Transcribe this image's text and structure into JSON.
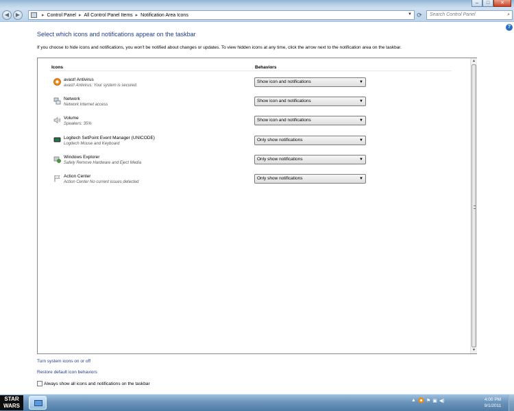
{
  "colors": {
    "link": "#1e3d8f",
    "avast_orange": "#f08a12",
    "network_gray": "#8f949a",
    "logitech_green": "#1c7a3a",
    "explorer_green": "#46a03a"
  },
  "nav": {
    "breadcrumb": [
      "Control Panel",
      "All Control Panel Items",
      "Notification Area Icons"
    ],
    "search_placeholder": "Search Control Panel"
  },
  "page": {
    "title": "Select which icons and notifications appear on the taskbar",
    "intro": "If you choose to hide icons and notifications, you won't be notified about changes or updates. To view hidden icons at any time, click the arrow next to the notification area on the taskbar."
  },
  "table": {
    "col_icons": "Icons",
    "col_behaviors": "Behaviors",
    "rows": [
      {
        "icon": "avast-icon",
        "name": "avast! Antivirus",
        "desc": "avast! Antivirus: Your system is secured.",
        "behavior": "Show icon and notifications"
      },
      {
        "icon": "network-icon",
        "name": "Network",
        "desc": "Network Internet access",
        "behavior": "Show icon and notifications"
      },
      {
        "icon": "volume-icon",
        "name": "Volume",
        "desc": "Speakers: 35%",
        "behavior": "Show icon and notifications"
      },
      {
        "icon": "logitech-icon",
        "name": "Logitech SetPoint Event Manager (UNICODE)",
        "desc": "Logitech Mouse and Keyboard",
        "behavior": "Only show notifications"
      },
      {
        "icon": "safely-remove-icon",
        "name": "Windows Explorer",
        "desc": "Safely Remove Hardware and Eject Media",
        "behavior": "Only show notifications"
      },
      {
        "icon": "flag-icon",
        "name": "Action Center",
        "desc": "Action Center  No current issues detected",
        "behavior": "Only show notifications"
      }
    ]
  },
  "links": {
    "system_icons": "Turn system icons on or off",
    "restore": "Restore default icon behaviors"
  },
  "checkbox": {
    "label": "Always show all icons and notifications on the taskbar",
    "checked": false
  },
  "taskbar": {
    "start_label": "STAR WARS",
    "time": "4:00 PM",
    "date": "9/1/2011"
  }
}
